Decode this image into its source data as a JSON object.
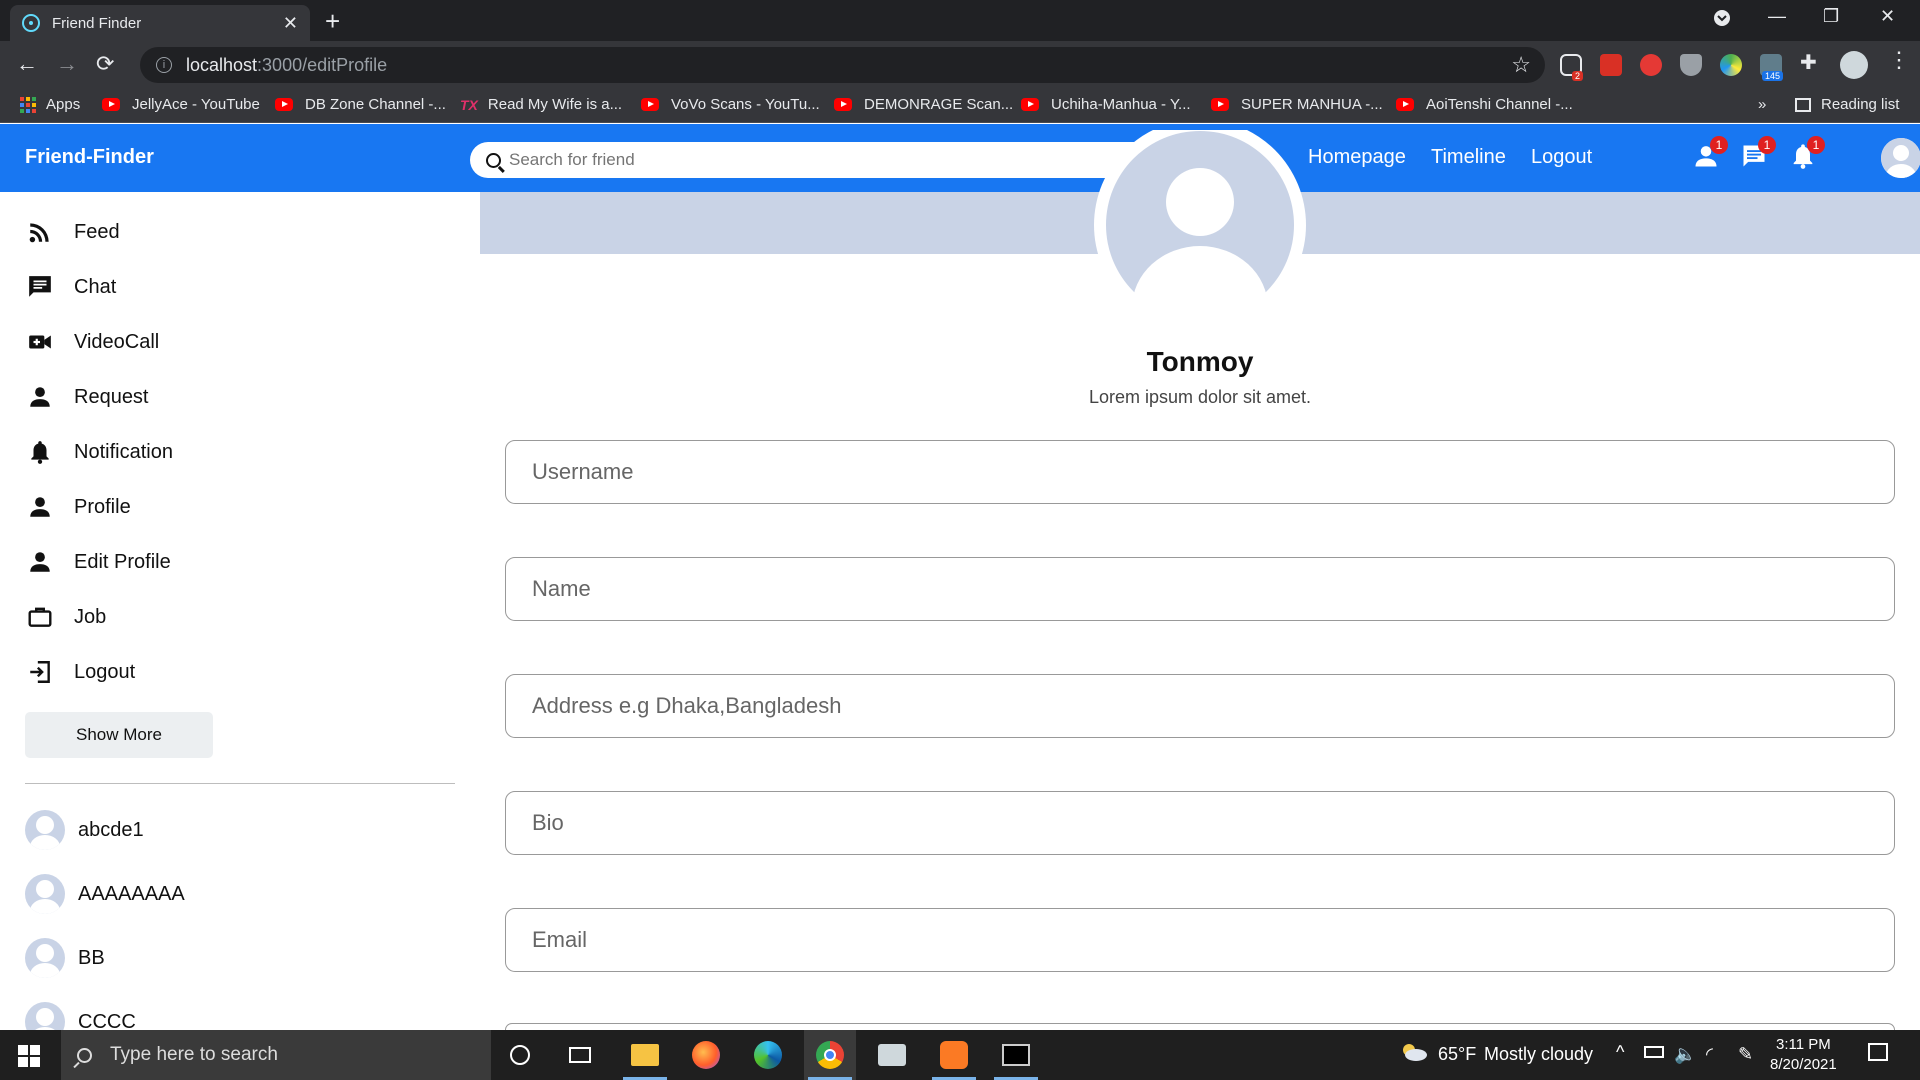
{
  "browser": {
    "tab_title": "Friend Finder",
    "url_host": "localhost",
    "url_path": ":3000/editProfile",
    "ext_badges": [
      "2",
      "145"
    ],
    "bookmarks": [
      {
        "label": "Apps",
        "icon": "apps-grid"
      },
      {
        "label": "JellyAce - YouTube",
        "icon": "youtube"
      },
      {
        "label": "DB Zone Channel -...",
        "icon": "youtube"
      },
      {
        "label": "Read My Wife is a...",
        "icon": "tx"
      },
      {
        "label": "VoVo Scans - YouTu...",
        "icon": "youtube"
      },
      {
        "label": "DEMONRAGE Scan...",
        "icon": "youtube"
      },
      {
        "label": "Uchiha-Manhua - Y...",
        "icon": "youtube"
      },
      {
        "label": "SUPER MANHUA -...",
        "icon": "youtube"
      },
      {
        "label": "AoiTenshi Channel -...",
        "icon": "youtube"
      }
    ],
    "more_bookmarks": "»",
    "reading_list": "Reading list"
  },
  "app": {
    "brand": "Friend-Finder",
    "search_placeholder": "Search for friend",
    "nav": [
      "Homepage",
      "Timeline",
      "Logout"
    ],
    "badges": {
      "requests": "1",
      "messages": "1",
      "notifications": "1"
    }
  },
  "sidebar": {
    "items": [
      {
        "label": "Feed",
        "icon": "rss-icon"
      },
      {
        "label": "Chat",
        "icon": "chat-icon"
      },
      {
        "label": "VideoCall",
        "icon": "videocam-icon"
      },
      {
        "label": "Request",
        "icon": "person-icon"
      },
      {
        "label": "Notification",
        "icon": "bell-icon"
      },
      {
        "label": "Profile",
        "icon": "person-icon"
      },
      {
        "label": "Edit Profile",
        "icon": "person-icon"
      },
      {
        "label": "Job",
        "icon": "briefcase-icon"
      },
      {
        "label": "Logout",
        "icon": "exit-icon"
      }
    ],
    "show_more": "Show More",
    "friends": [
      "abcde1",
      "AAAAAAAA",
      "BB",
      "CCCC"
    ]
  },
  "profile": {
    "name": "Tonmoy",
    "bio": "Lorem ipsum dolor sit amet.",
    "fields": [
      {
        "placeholder": "Username"
      },
      {
        "placeholder": "Name"
      },
      {
        "placeholder": "Address e.g Dhaka,Bangladesh"
      },
      {
        "placeholder": "Bio"
      },
      {
        "placeholder": "Email"
      }
    ]
  },
  "taskbar": {
    "search_placeholder": "Type here to search",
    "weather_temp": "65°F",
    "weather_text": "Mostly cloudy",
    "time": "3:11 PM",
    "date": "8/20/2021"
  },
  "colors": {
    "brand_blue": "#1877f2",
    "cover": "#c9d3e6",
    "badge_red": "#e02020"
  }
}
